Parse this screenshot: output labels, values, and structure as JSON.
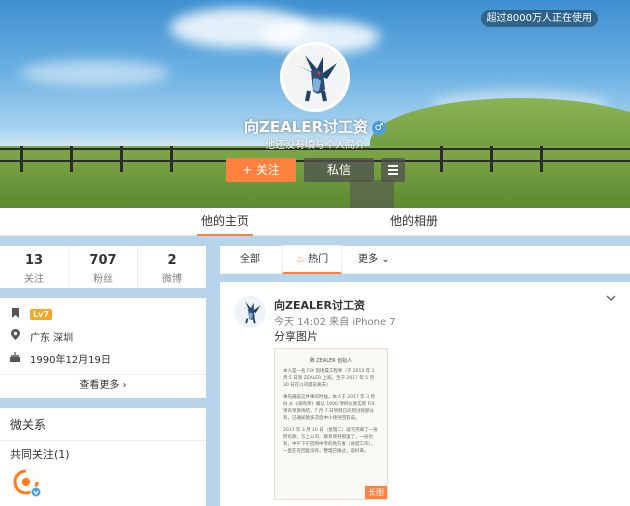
{
  "cover": {
    "badge": "超过8000万人正在使用"
  },
  "profile": {
    "name": "向ZEALER讨工资",
    "gender_symbol": "♂",
    "intro": "他还没有填写个人简介",
    "follow_label": "+ 关注",
    "message_label": "私信"
  },
  "tabs": [
    {
      "label": "他的主页",
      "active": true
    },
    {
      "label": "他的相册",
      "active": false
    }
  ],
  "stats": [
    {
      "value": "13",
      "label": "关注"
    },
    {
      "value": "707",
      "label": "粉丝"
    },
    {
      "value": "2",
      "label": "微博"
    }
  ],
  "info": {
    "level": "Lv7",
    "location": "广东 深圳",
    "birthday": "1990年12月19日",
    "learn_more": "查看更多 ›"
  },
  "relations": {
    "title": "微关系",
    "common_follow": "共同关注(1)"
  },
  "feed_filters": [
    {
      "label": "全部",
      "active": false
    },
    {
      "label": "热门",
      "active": true
    },
    {
      "label": "更多",
      "active": false
    }
  ],
  "post": {
    "author": "向ZEALER讨工资",
    "time_source": "今天 14:02 来自 iPhone 7",
    "text": "分享图片",
    "image_title": "致 ZEALER 创始人",
    "image_paragraphs": [
      "本人是一名 FIX 现场操工程师（于 2013 年 1 月 5 日到 ZEALER 上班，至于 2017 年 5 月 30 日在公司提前离去）",
      "事先确说这件事的时候，本人于 2017 年 3 月 份 从《采购单》确认 1000 项目价款实际 FIX 项有项目待结，7 月 7 日项目已问到讨款部分有，已通知我多次后中小领导回答说。",
      "2017 年 3 月 10 日（星期二）就写完邮了一份所有款，写上公司、联系领导那里了，一份也有，中午下午回到中专的地方发（总结工作），一直在有回复没有，整理已报过，说好来。"
    ],
    "long_tag": "长图"
  },
  "colors": {
    "accent": "#ff8140",
    "background": "#b7d4ea"
  }
}
